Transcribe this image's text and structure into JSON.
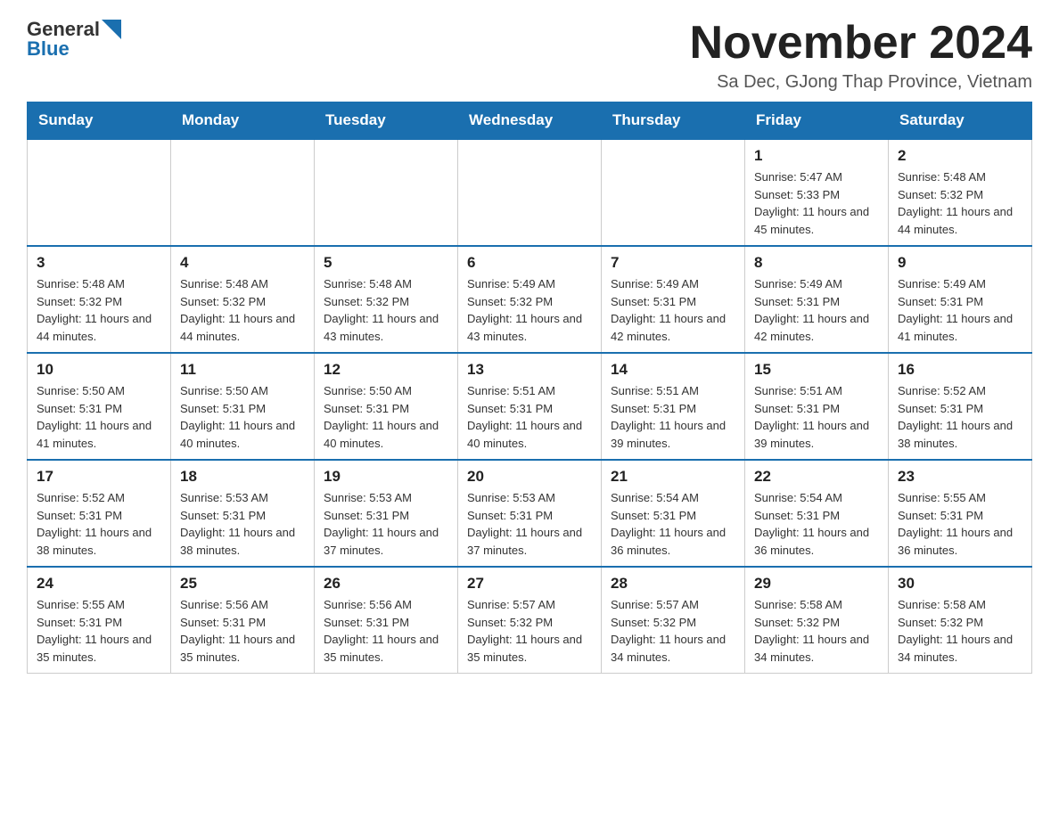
{
  "header": {
    "logo": {
      "general": "General",
      "blue": "Blue",
      "triangle_color": "#1a6faf"
    },
    "title": "November 2024",
    "location": "Sa Dec, GJong Thap Province, Vietnam"
  },
  "calendar": {
    "days_of_week": [
      "Sunday",
      "Monday",
      "Tuesday",
      "Wednesday",
      "Thursday",
      "Friday",
      "Saturday"
    ],
    "weeks": [
      [
        {
          "day": "",
          "info": ""
        },
        {
          "day": "",
          "info": ""
        },
        {
          "day": "",
          "info": ""
        },
        {
          "day": "",
          "info": ""
        },
        {
          "day": "",
          "info": ""
        },
        {
          "day": "1",
          "info": "Sunrise: 5:47 AM\nSunset: 5:33 PM\nDaylight: 11 hours and 45 minutes."
        },
        {
          "day": "2",
          "info": "Sunrise: 5:48 AM\nSunset: 5:32 PM\nDaylight: 11 hours and 44 minutes."
        }
      ],
      [
        {
          "day": "3",
          "info": "Sunrise: 5:48 AM\nSunset: 5:32 PM\nDaylight: 11 hours and 44 minutes."
        },
        {
          "day": "4",
          "info": "Sunrise: 5:48 AM\nSunset: 5:32 PM\nDaylight: 11 hours and 44 minutes."
        },
        {
          "day": "5",
          "info": "Sunrise: 5:48 AM\nSunset: 5:32 PM\nDaylight: 11 hours and 43 minutes."
        },
        {
          "day": "6",
          "info": "Sunrise: 5:49 AM\nSunset: 5:32 PM\nDaylight: 11 hours and 43 minutes."
        },
        {
          "day": "7",
          "info": "Sunrise: 5:49 AM\nSunset: 5:31 PM\nDaylight: 11 hours and 42 minutes."
        },
        {
          "day": "8",
          "info": "Sunrise: 5:49 AM\nSunset: 5:31 PM\nDaylight: 11 hours and 42 minutes."
        },
        {
          "day": "9",
          "info": "Sunrise: 5:49 AM\nSunset: 5:31 PM\nDaylight: 11 hours and 41 minutes."
        }
      ],
      [
        {
          "day": "10",
          "info": "Sunrise: 5:50 AM\nSunset: 5:31 PM\nDaylight: 11 hours and 41 minutes."
        },
        {
          "day": "11",
          "info": "Sunrise: 5:50 AM\nSunset: 5:31 PM\nDaylight: 11 hours and 40 minutes."
        },
        {
          "day": "12",
          "info": "Sunrise: 5:50 AM\nSunset: 5:31 PM\nDaylight: 11 hours and 40 minutes."
        },
        {
          "day": "13",
          "info": "Sunrise: 5:51 AM\nSunset: 5:31 PM\nDaylight: 11 hours and 40 minutes."
        },
        {
          "day": "14",
          "info": "Sunrise: 5:51 AM\nSunset: 5:31 PM\nDaylight: 11 hours and 39 minutes."
        },
        {
          "day": "15",
          "info": "Sunrise: 5:51 AM\nSunset: 5:31 PM\nDaylight: 11 hours and 39 minutes."
        },
        {
          "day": "16",
          "info": "Sunrise: 5:52 AM\nSunset: 5:31 PM\nDaylight: 11 hours and 38 minutes."
        }
      ],
      [
        {
          "day": "17",
          "info": "Sunrise: 5:52 AM\nSunset: 5:31 PM\nDaylight: 11 hours and 38 minutes."
        },
        {
          "day": "18",
          "info": "Sunrise: 5:53 AM\nSunset: 5:31 PM\nDaylight: 11 hours and 38 minutes."
        },
        {
          "day": "19",
          "info": "Sunrise: 5:53 AM\nSunset: 5:31 PM\nDaylight: 11 hours and 37 minutes."
        },
        {
          "day": "20",
          "info": "Sunrise: 5:53 AM\nSunset: 5:31 PM\nDaylight: 11 hours and 37 minutes."
        },
        {
          "day": "21",
          "info": "Sunrise: 5:54 AM\nSunset: 5:31 PM\nDaylight: 11 hours and 36 minutes."
        },
        {
          "day": "22",
          "info": "Sunrise: 5:54 AM\nSunset: 5:31 PM\nDaylight: 11 hours and 36 minutes."
        },
        {
          "day": "23",
          "info": "Sunrise: 5:55 AM\nSunset: 5:31 PM\nDaylight: 11 hours and 36 minutes."
        }
      ],
      [
        {
          "day": "24",
          "info": "Sunrise: 5:55 AM\nSunset: 5:31 PM\nDaylight: 11 hours and 35 minutes."
        },
        {
          "day": "25",
          "info": "Sunrise: 5:56 AM\nSunset: 5:31 PM\nDaylight: 11 hours and 35 minutes."
        },
        {
          "day": "26",
          "info": "Sunrise: 5:56 AM\nSunset: 5:31 PM\nDaylight: 11 hours and 35 minutes."
        },
        {
          "day": "27",
          "info": "Sunrise: 5:57 AM\nSunset: 5:32 PM\nDaylight: 11 hours and 35 minutes."
        },
        {
          "day": "28",
          "info": "Sunrise: 5:57 AM\nSunset: 5:32 PM\nDaylight: 11 hours and 34 minutes."
        },
        {
          "day": "29",
          "info": "Sunrise: 5:58 AM\nSunset: 5:32 PM\nDaylight: 11 hours and 34 minutes."
        },
        {
          "day": "30",
          "info": "Sunrise: 5:58 AM\nSunset: 5:32 PM\nDaylight: 11 hours and 34 minutes."
        }
      ]
    ]
  }
}
